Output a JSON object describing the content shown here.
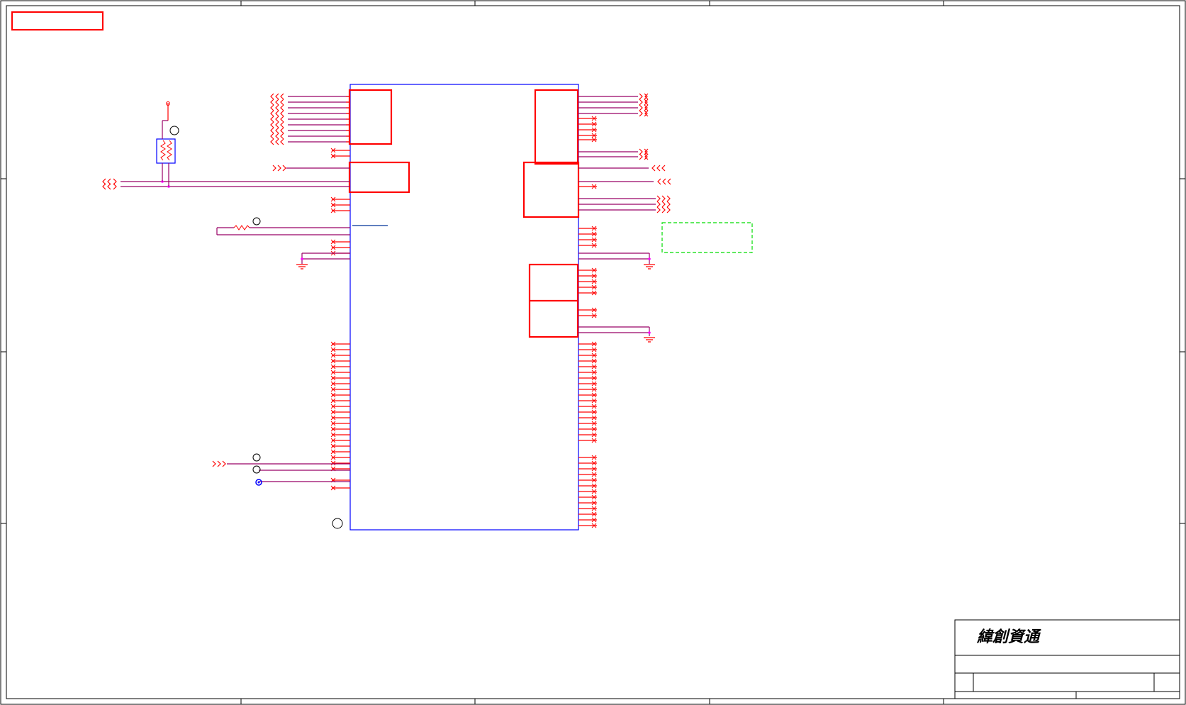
{
  "title_block": {
    "company": "緯創資通"
  },
  "colors": {
    "wire": "#990066",
    "pin": "#ff0000",
    "body": "#0000ff",
    "net_node": "#ff00ff",
    "highlight_box": "#ff0000",
    "note_box": "#00dd00",
    "frame": "#000000"
  },
  "icons": {
    "offpage_connector": "chevron-arrow-icon",
    "ground": "ground-icon",
    "resistor": "resistor-icon",
    "test_point": "test-point-icon",
    "no_connect": "no-connect-x-icon"
  }
}
